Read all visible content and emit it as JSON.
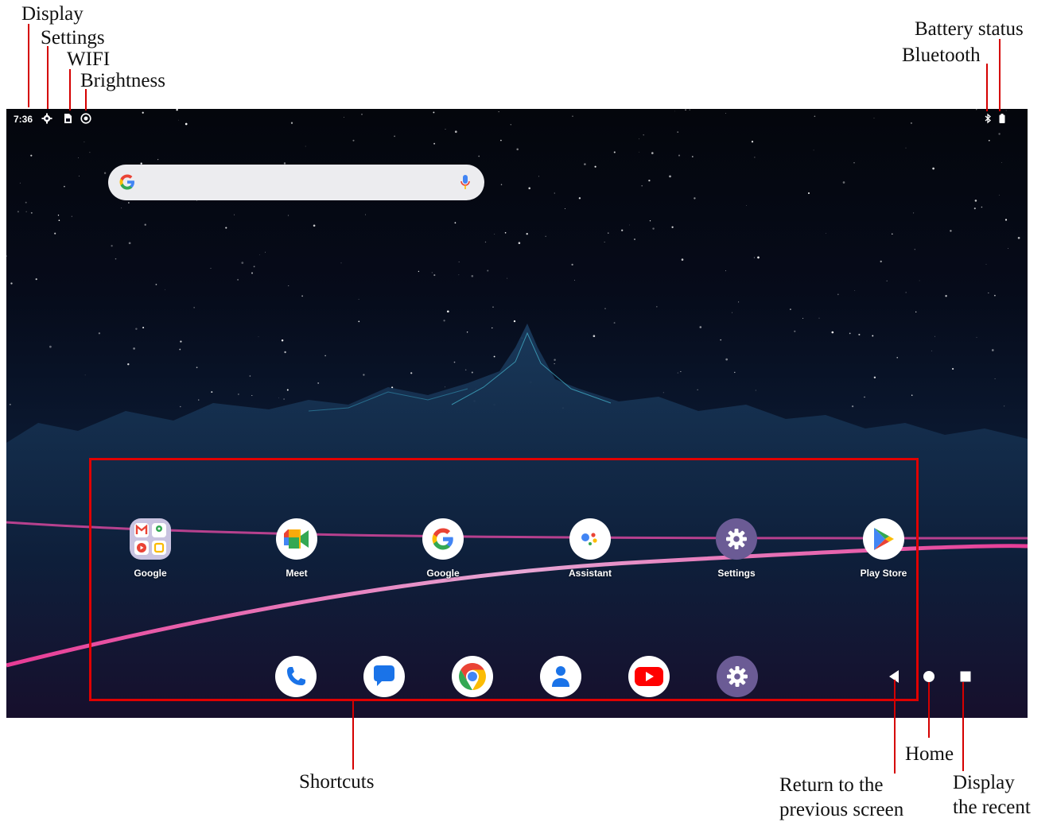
{
  "annotations": {
    "display": "Display",
    "settings": "Settings",
    "wifi": "WIFI",
    "brightness": "Brightness",
    "battery_status": "Battery status",
    "bluetooth": "Bluetooth",
    "shortcuts": "Shortcuts",
    "home": "Home",
    "return_line1": "Return to the",
    "return_line2": "previous screen",
    "recent_line1": "Display",
    "recent_line2": "the recent"
  },
  "status_bar": {
    "time": "7:36",
    "left_icons": [
      "gear-icon",
      "sim-icon",
      "brightness-icon"
    ],
    "right_icons": [
      "bluetooth-icon",
      "battery-icon"
    ]
  },
  "search_bar": {
    "left_icon": "google-g-icon",
    "right_icon": "microphone-icon"
  },
  "home_apps": [
    {
      "label": "Google",
      "icon": "google-folder-icon"
    },
    {
      "label": "Meet",
      "icon": "meet-icon"
    },
    {
      "label": "Google",
      "icon": "google-icon"
    },
    {
      "label": "Assistant",
      "icon": "assistant-icon"
    },
    {
      "label": "Settings",
      "icon": "settings-icon"
    },
    {
      "label": "Play Store",
      "icon": "play-store-icon"
    }
  ],
  "dock": [
    "phone-icon",
    "messages-icon",
    "chrome-icon",
    "contacts-icon",
    "youtube-icon",
    "settings-icon"
  ],
  "nav_buttons": [
    "back-icon",
    "home-icon",
    "recents-icon"
  ],
  "colors": {
    "annotation_red": "#e00000",
    "google_blue": "#4285f4",
    "google_red": "#ea4335",
    "google_yellow": "#fbbc04",
    "google_green": "#34a853",
    "settings_purple": "#6b5b95"
  }
}
